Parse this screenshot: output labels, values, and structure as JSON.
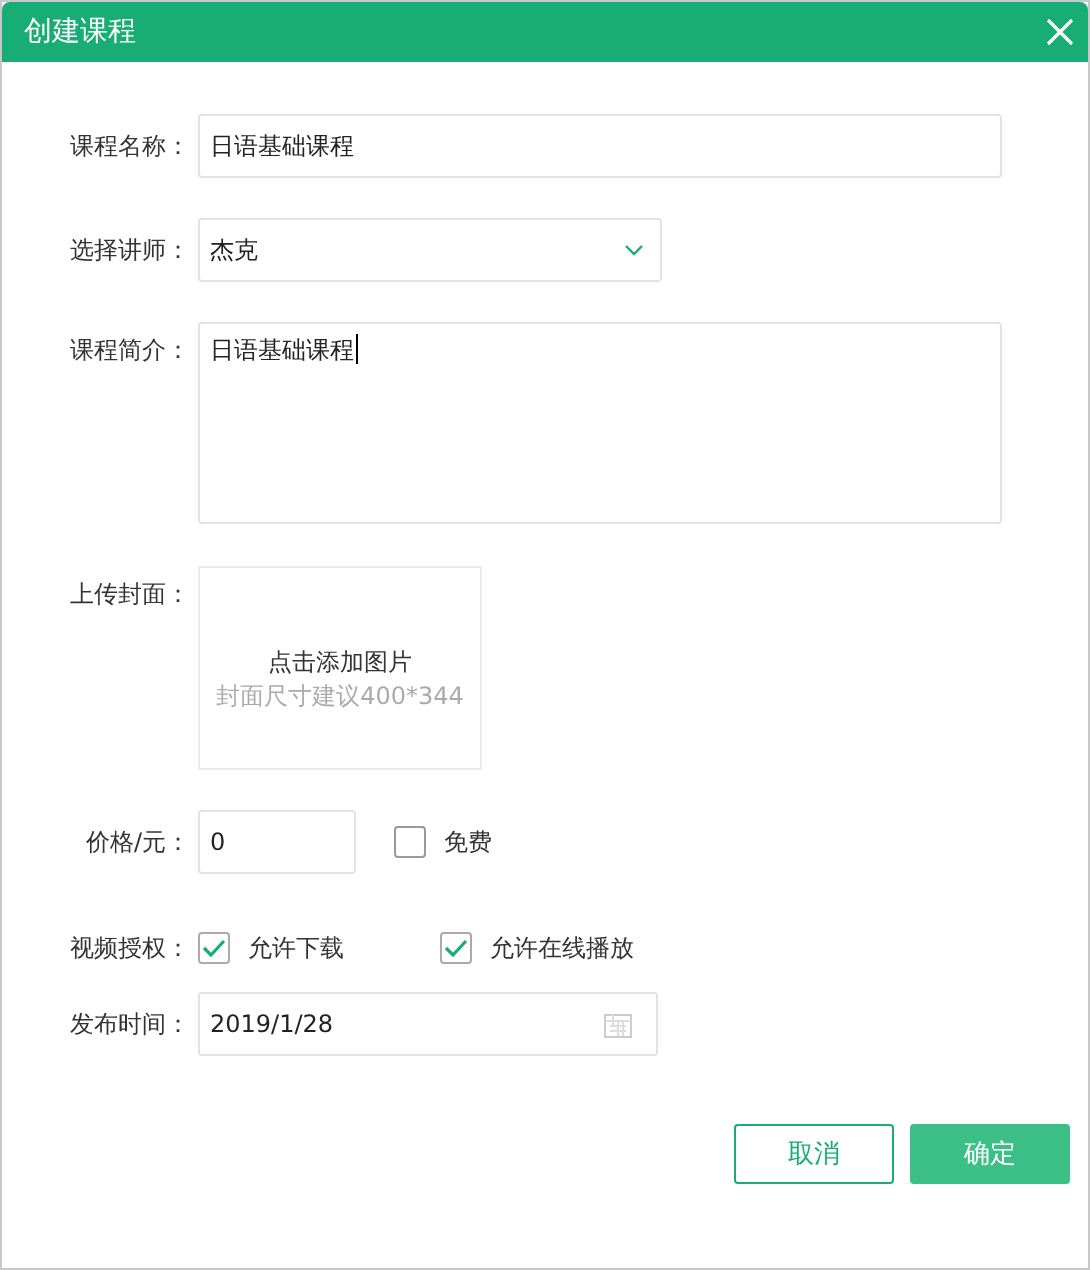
{
  "window": {
    "title": "创建课程"
  },
  "course_name": {
    "label": "课程名称：",
    "value": "日语基础课程"
  },
  "teacher": {
    "label": "选择讲师：",
    "value": "杰克"
  },
  "intro": {
    "label": "课程简介：",
    "value": "日语基础课程"
  },
  "cover": {
    "label": "上传封面：",
    "action": "点击添加图片",
    "hint": "封面尺寸建议400*344"
  },
  "price": {
    "label": "价格/元：",
    "value": "0",
    "free": {
      "label": "免费",
      "checked": false
    }
  },
  "license": {
    "label": "视频授权：",
    "options": [
      {
        "label": "允许下载",
        "checked": true
      },
      {
        "label": "允许在线播放",
        "checked": true
      }
    ]
  },
  "publish": {
    "label": "发布时间：",
    "value": "2019/1/28"
  },
  "buttons": [
    {
      "label": "取消",
      "kind": "secondary"
    },
    {
      "label": "确定",
      "kind": "primary"
    }
  ]
}
